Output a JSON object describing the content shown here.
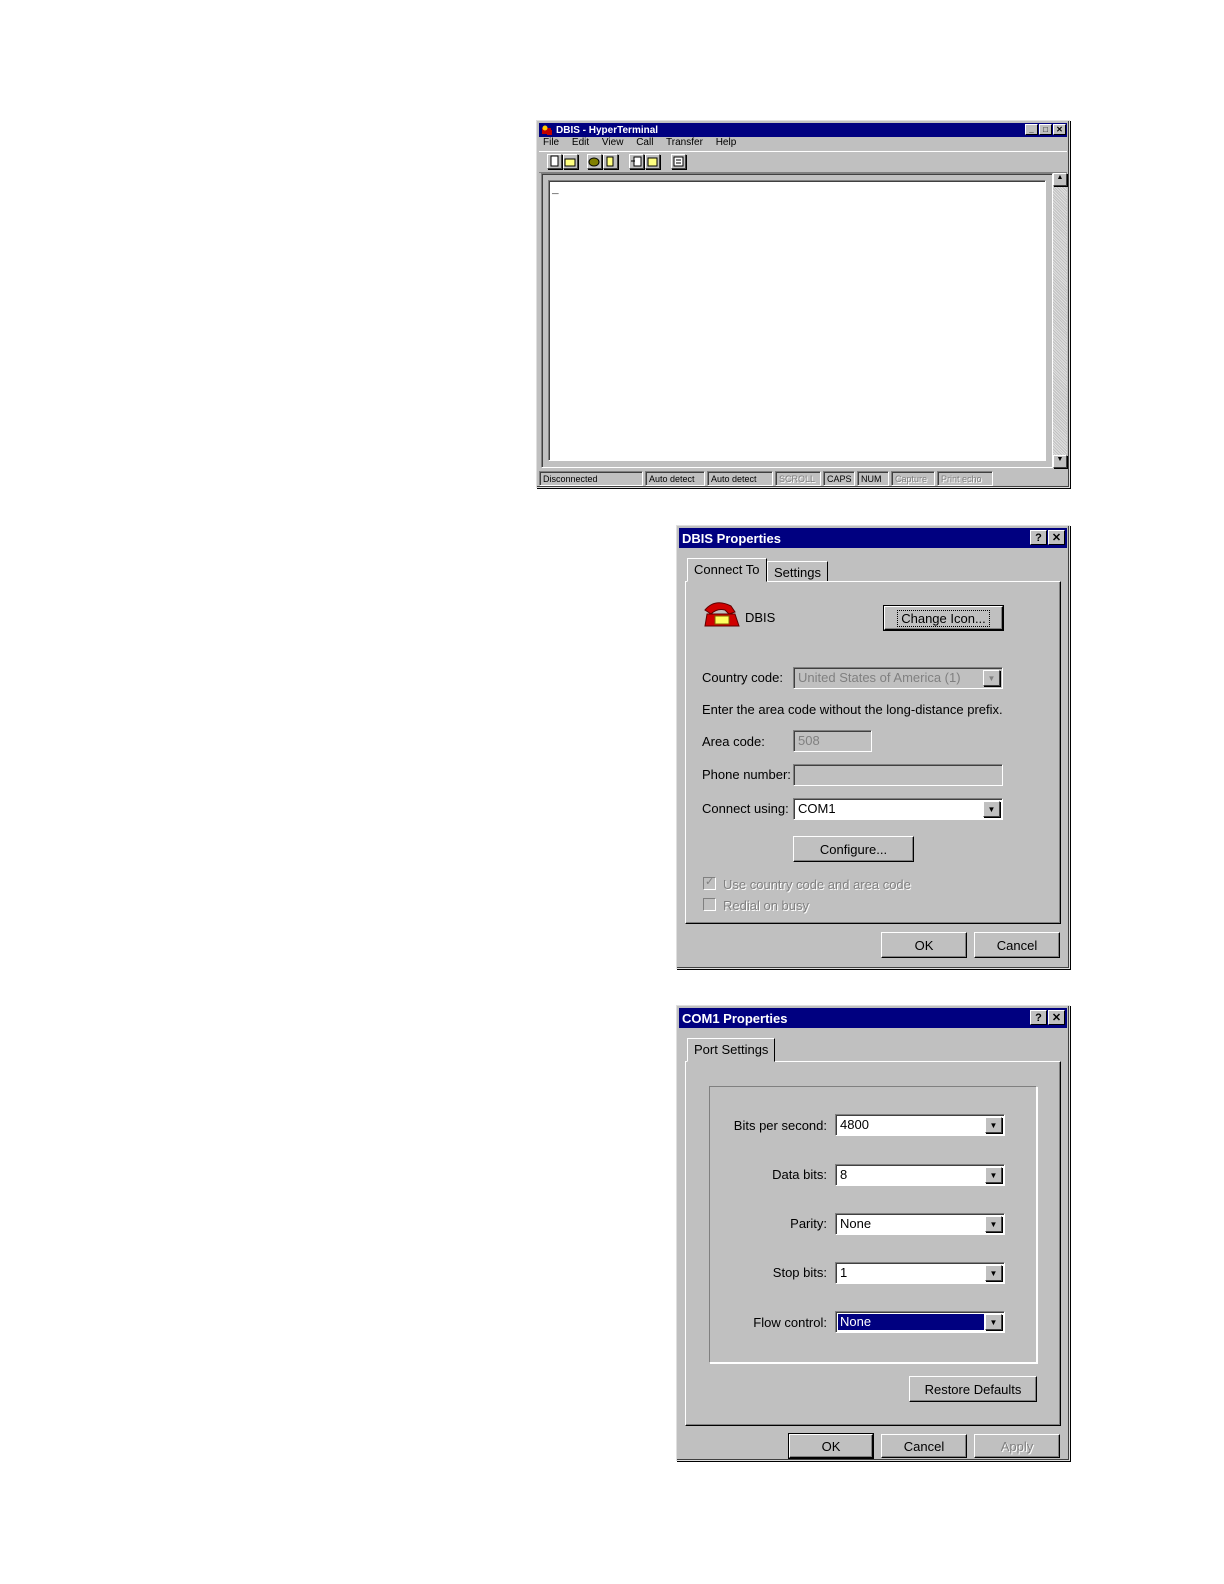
{
  "hyperterminal": {
    "title": "DBIS - HyperTerminal",
    "menu": [
      "File",
      "Edit",
      "View",
      "Call",
      "Transfer",
      "Help"
    ],
    "cursor": "_",
    "status": [
      "Disconnected",
      "Auto detect",
      "Auto detect",
      "SCROLL",
      "CAPS",
      "NUM",
      "Capture",
      "Print echo"
    ]
  },
  "dbis_props": {
    "title": "DBIS Properties",
    "help_glyph": "?",
    "close_glyph": "✕",
    "tabs": [
      "Connect To",
      "Settings"
    ],
    "icon_name": "DBIS",
    "change_icon_label": "Change Icon...",
    "country_label": "Country code:",
    "country_value": "United States of America (1)",
    "area_hint": "Enter the area code without the long-distance prefix.",
    "area_label": "Area code:",
    "area_value": "508",
    "phone_label": "Phone number:",
    "phone_value": "",
    "connect_label": "Connect using:",
    "connect_value": "COM1",
    "configure_label": "Configure...",
    "use_country_label": "Use country code and area code",
    "redial_label": "Redial on busy",
    "ok_label": "OK",
    "cancel_label": "Cancel"
  },
  "com1_props": {
    "title": "COM1 Properties",
    "help_glyph": "?",
    "close_glyph": "✕",
    "tab": "Port Settings",
    "bits_label": "Bits per second:",
    "bits_value": "4800",
    "data_label": "Data bits:",
    "data_value": "8",
    "parity_label": "Parity:",
    "parity_value": "None",
    "stop_label": "Stop bits:",
    "stop_value": "1",
    "flow_label": "Flow control:",
    "flow_value": "None",
    "restore_label": "Restore Defaults",
    "ok_label": "OK",
    "cancel_label": "Cancel",
    "apply_label": "Apply"
  }
}
